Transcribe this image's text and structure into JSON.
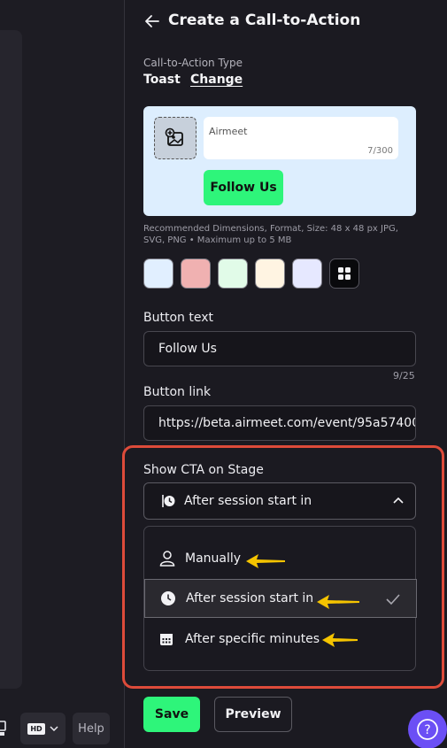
{
  "header": {
    "title": "Create a Call-to-Action",
    "back_icon": "arrow-left-icon"
  },
  "cta_type": {
    "label": "Call-to-Action Type",
    "value": "Toast",
    "change_link": "Change"
  },
  "preview": {
    "upload_icon": "image-add-icon",
    "toast_text": "Airmeet",
    "char_count": "7/300",
    "button_label": "Follow Us",
    "background_color": "#ddeefe",
    "button_color": "#2ef57a"
  },
  "dimensions_note": "Recommended Dimensions, Format, Size: 48 x 48 px JPG, SVG, PNG • Maximum up to 5 MB",
  "swatches": [
    "#e1efff",
    "#f0b1b1",
    "#e1fbe8",
    "#fff4e2",
    "#e6e8ff"
  ],
  "more_colors_icon": "grid-icon",
  "button_text": {
    "label": "Button text",
    "value": "Follow Us",
    "counter": "9/25"
  },
  "button_link": {
    "label": "Button link",
    "value": "https://beta.airmeet.com/event/95a57400"
  },
  "show_cta": {
    "label": "Show CTA on Stage",
    "selected": "After session start in",
    "options": [
      {
        "label": "Manually",
        "icon": "person-icon"
      },
      {
        "label": "After session start in",
        "icon": "clock-icon"
      },
      {
        "label": "After specific minutes",
        "icon": "calendar-icon"
      }
    ],
    "annotation_color": "#dd4b3a",
    "arrow_color": "#f5c400"
  },
  "actions": {
    "save": "Save",
    "preview": "Preview"
  },
  "left_toolbar": {
    "hd_label": "HD",
    "help_label": "Help"
  },
  "help_fab_label": "?"
}
